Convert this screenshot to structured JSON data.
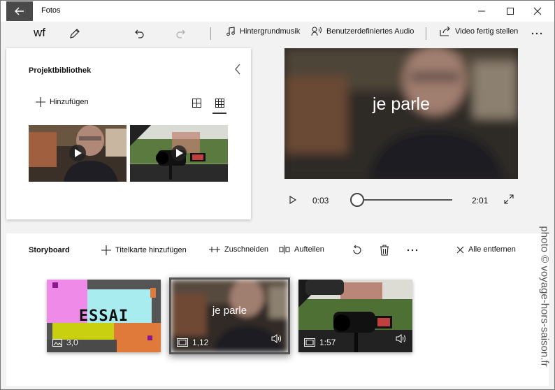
{
  "window": {
    "app_title": "Fotos",
    "controls": [
      "minimize",
      "maximize",
      "close"
    ]
  },
  "toolbar": {
    "project_name": "wf",
    "background_music_label": "Hintergrundmusik",
    "custom_audio_label": "Benutzerdefiniertes Audio",
    "finish_video_label": "Video fertig stellen"
  },
  "library": {
    "title": "Projektbibliothek",
    "add_label": "Hinzufügen",
    "items": [
      {
        "type": "video",
        "name": "person-in-car"
      },
      {
        "type": "video",
        "name": "camera-on-dashboard"
      }
    ]
  },
  "preview": {
    "caption": "je parle",
    "current_time": "0:03",
    "total_time": "2:01",
    "progress": 0.025
  },
  "storyboard": {
    "title": "Storyboard",
    "add_title_card_label": "Titelkarte hinzufügen",
    "trim_label": "Zuschneiden",
    "split_label": "Aufteilen",
    "remove_all_label": "Alle entfernen",
    "clips": [
      {
        "kind": "title-card",
        "text": "ESSAI",
        "duration": "3,0",
        "audio": false,
        "selected": false
      },
      {
        "kind": "video",
        "caption": "je parle",
        "duration": "1,12",
        "audio": true,
        "selected": true
      },
      {
        "kind": "video",
        "duration": "1:57",
        "audio": true,
        "selected": false
      }
    ]
  },
  "watermark": "photo © voyage-hors-saison.fr",
  "colors": {
    "back_button": "#4a4a4a",
    "panel": "#ffffff",
    "app_background": "#f2f2f2",
    "title_card_pink": "#f08ae8",
    "title_card_cyan": "#a8ecf0",
    "title_card_yellow": "#c8d010",
    "title_card_orange": "#e07a3a"
  }
}
